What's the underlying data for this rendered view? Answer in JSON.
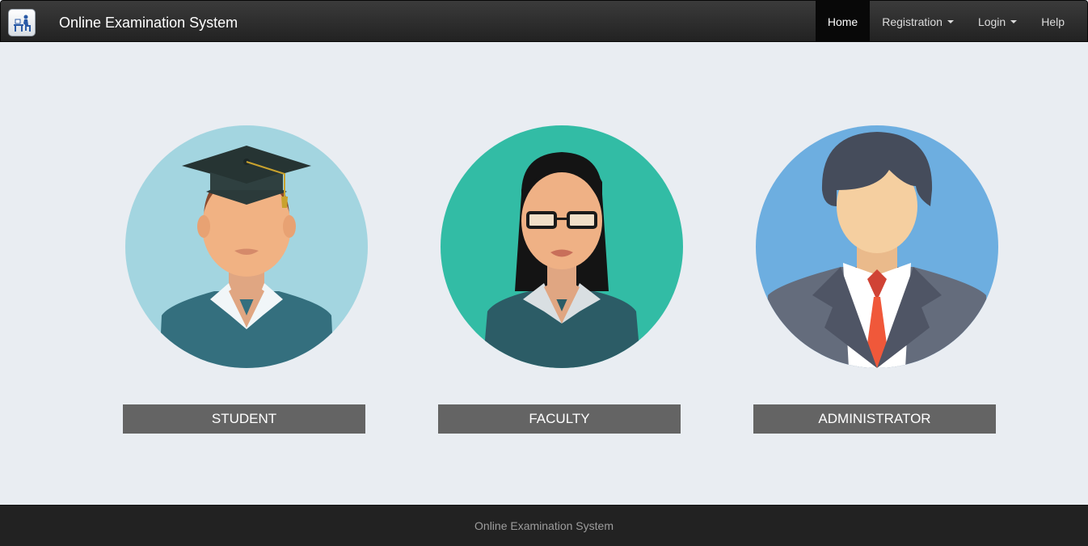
{
  "brand": {
    "title": "Online Examination System",
    "logo_icon": "exam-desk-icon"
  },
  "nav": {
    "items": [
      {
        "label": "Home",
        "active": true
      },
      {
        "label": "Registration",
        "dropdown": true
      },
      {
        "label": "Login",
        "dropdown": true
      },
      {
        "label": "Help"
      }
    ]
  },
  "roles": [
    {
      "label": "STUDENT",
      "icon": "student-avatar-icon",
      "circle_color": "#a3d5e0"
    },
    {
      "label": "FACULTY",
      "icon": "faculty-avatar-icon",
      "circle_color": "#32bca5"
    },
    {
      "label": "ADMINISTRATOR",
      "icon": "administrator-avatar-icon",
      "circle_color": "#6daee0"
    }
  ],
  "footer": {
    "text": "Online Examination System"
  },
  "colors": {
    "navbar": "#222222",
    "page_background": "#e9edf2",
    "role_button": "#646464"
  }
}
